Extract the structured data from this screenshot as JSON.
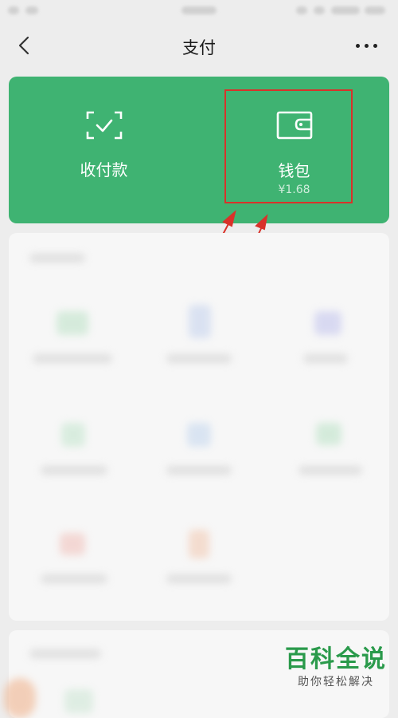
{
  "nav": {
    "title": "支付"
  },
  "pay_card": {
    "collect": {
      "label": "收付款",
      "icon": "scan-check-icon"
    },
    "wallet": {
      "label": "钱包",
      "balance": "¥1.68",
      "icon": "wallet-icon"
    }
  },
  "annotation": {
    "color": "#d9322a"
  },
  "brand": {
    "green": "#3fb372"
  },
  "watermark": {
    "title": "百科全说",
    "subtitle": "助你轻松解决"
  }
}
